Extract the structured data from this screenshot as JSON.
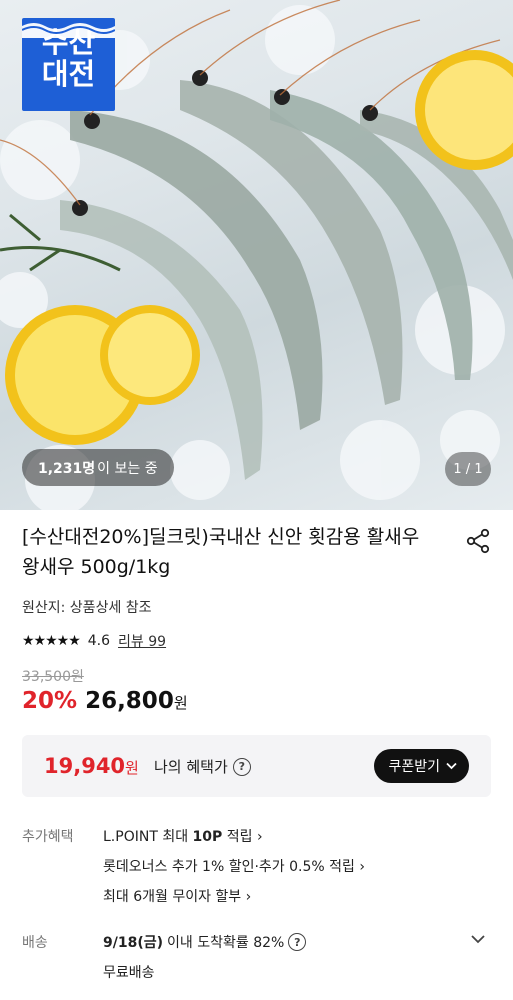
{
  "hero": {
    "badge_line1": "수산",
    "badge_line2": "대전",
    "viewers_count": "1,231명",
    "viewers_suffix": "이 보는 중",
    "pager": "1 / 1"
  },
  "product": {
    "title": "[수산대전20%]딜크릿)국내산 신안 횟감용 활새우 왕새우 500g/1kg",
    "origin": "원산지: 상품상세 참조",
    "stars": "★★★★★",
    "rating": "4.6",
    "review": "리뷰 99",
    "original_price": "33,500원",
    "discount": "20%",
    "price": "26,800",
    "price_unit": "원"
  },
  "benefit": {
    "price": "19,940",
    "price_unit": "원",
    "label": "나의 혜택가",
    "help": "?",
    "coupon_button": "쿠폰받기"
  },
  "extra": {
    "label": "추가혜택",
    "line1_pre": "L.POINT 최대 ",
    "line1_bold": "10P",
    "line1_post": " 적립 ›",
    "line2": "롯데오너스 추가 1% 할인·추가 0.5% 적립 ›",
    "line3": "최대 6개월 무이자 할부 ›"
  },
  "delivery": {
    "label": "배송",
    "date": "9/18(금)",
    "text": " 이내 도착확률 82%",
    "help": "?",
    "free": "무료배송"
  },
  "colors": {
    "accent_red": "#e0242b",
    "badge_blue": "#1e5fd6"
  }
}
